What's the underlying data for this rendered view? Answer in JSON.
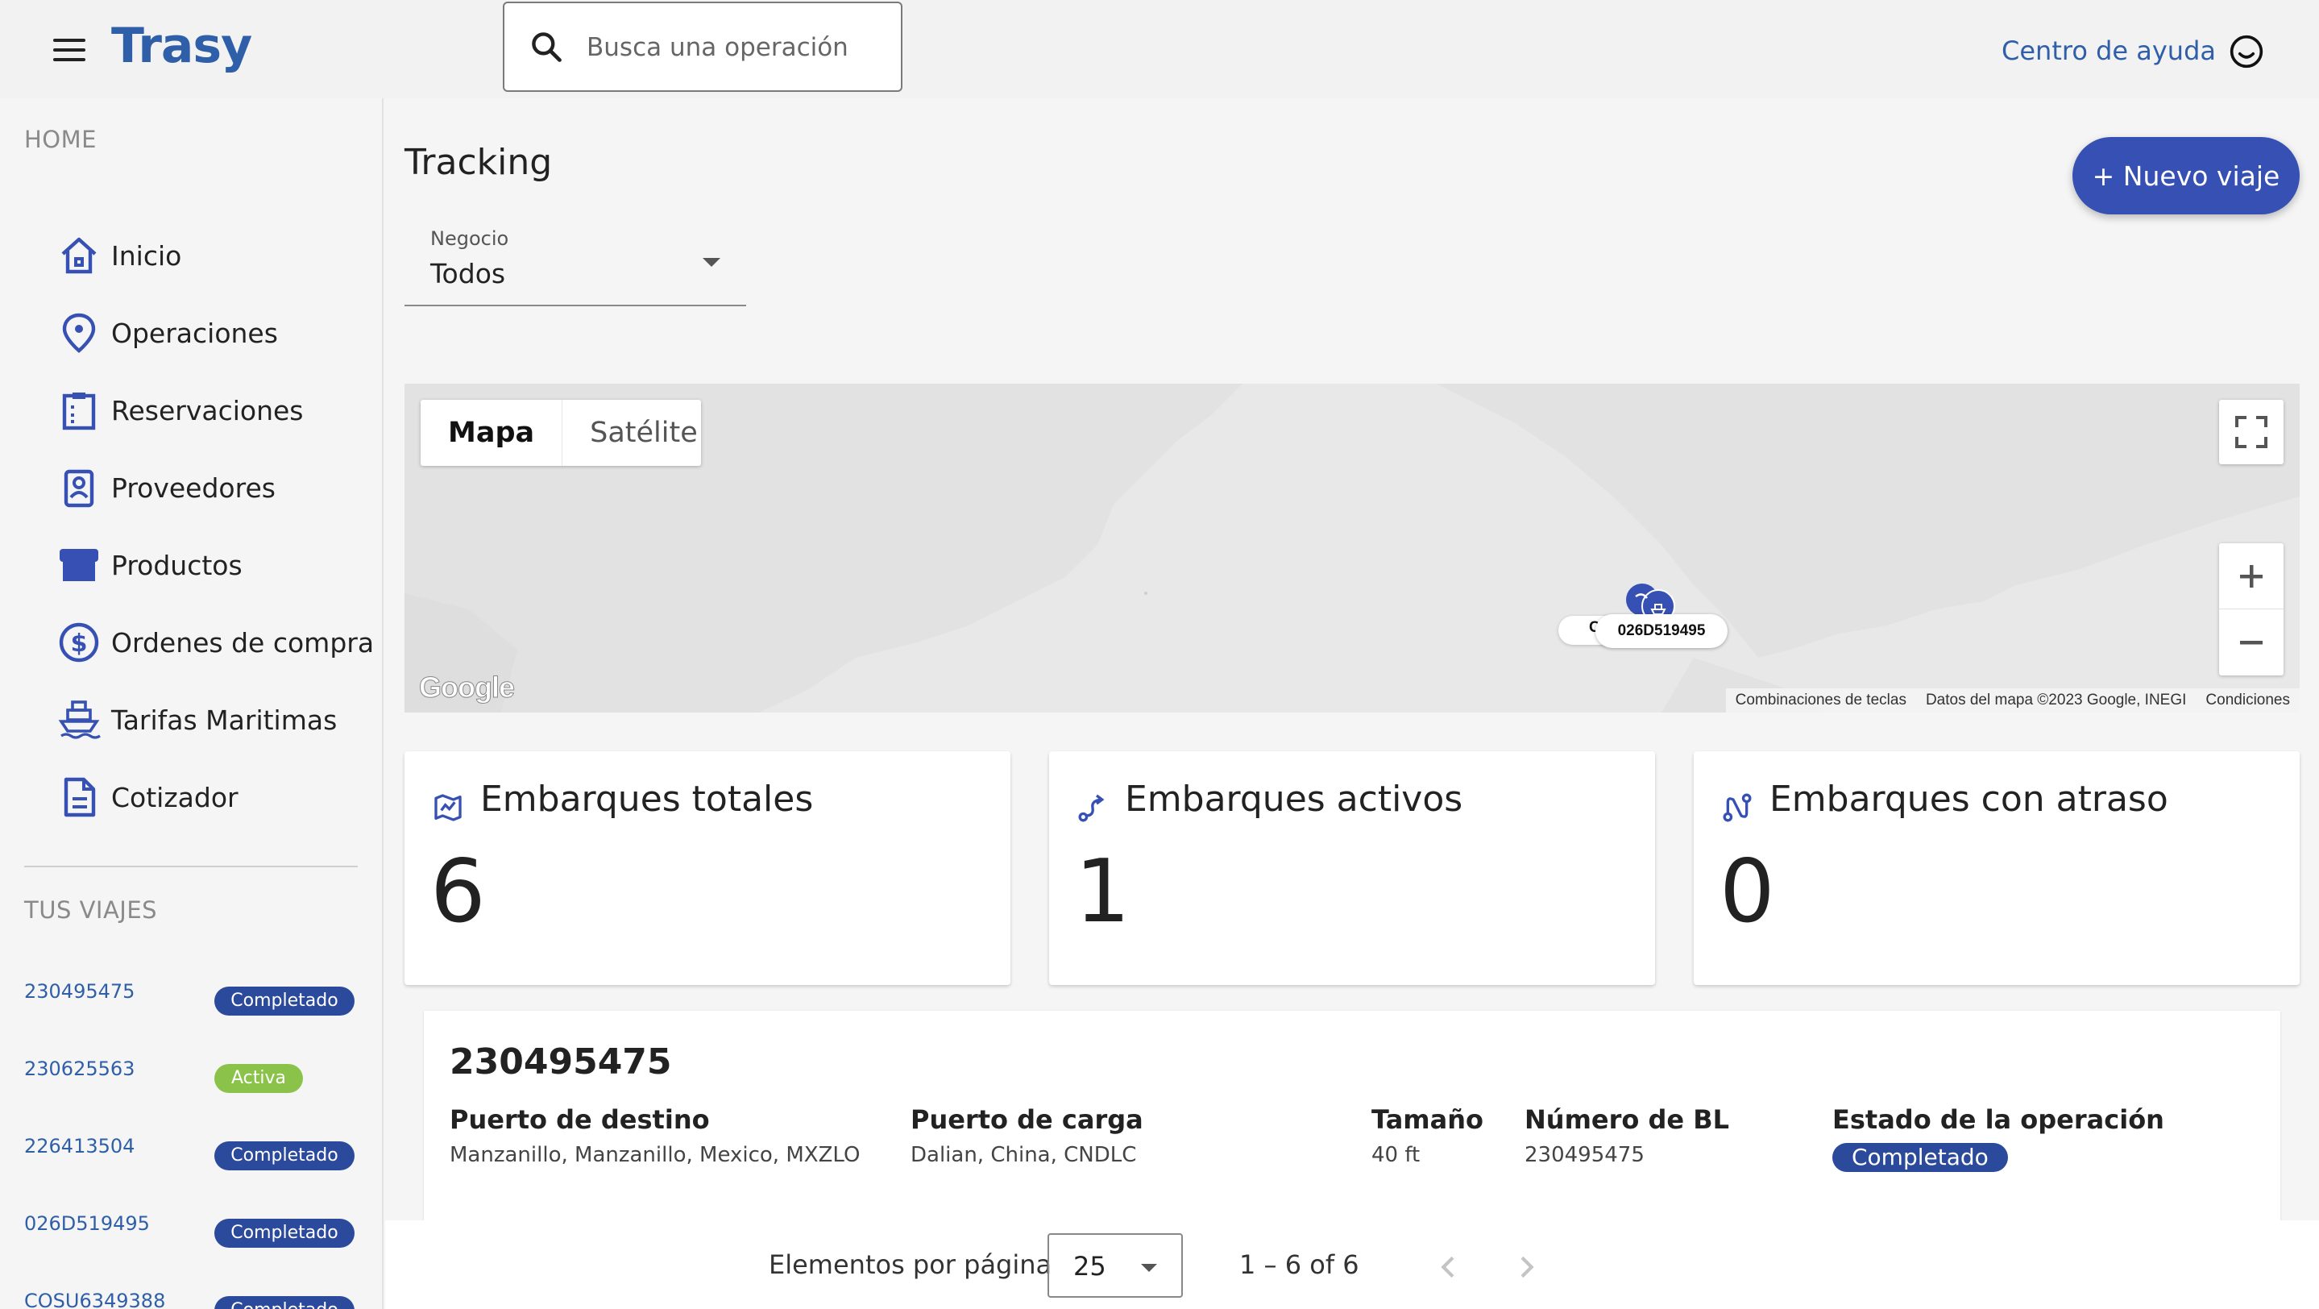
{
  "header": {
    "logo": "Trasy",
    "search_placeholder": "Busca una operación",
    "help_link": "Centro de ayuda"
  },
  "sidebar": {
    "home_label": "HOME",
    "items": [
      {
        "label": "Inicio",
        "icon": "home-icon"
      },
      {
        "label": "Operaciones",
        "icon": "location-pin-icon"
      },
      {
        "label": "Reservaciones",
        "icon": "clipboard-icon"
      },
      {
        "label": "Proveedores",
        "icon": "contact-card-icon"
      },
      {
        "label": "Productos",
        "icon": "store-icon"
      },
      {
        "label": "Ordenes de compra",
        "icon": "dollar-circle-icon"
      },
      {
        "label": "Tarifas Maritimas",
        "icon": "ship-icon"
      },
      {
        "label": "Cotizador",
        "icon": "document-icon"
      }
    ],
    "trips_label": "TUS VIAJES",
    "trips": [
      {
        "id": "230495475",
        "status": "Completado"
      },
      {
        "id": "230625563",
        "status": "Activa"
      },
      {
        "id": "226413504",
        "status": "Completado"
      },
      {
        "id": "026D519495",
        "status": "Completado"
      },
      {
        "id": "COSU6349388",
        "status": "Completado"
      }
    ]
  },
  "main": {
    "title": "Tracking",
    "new_trip_button": "+ Nuevo viaje",
    "business_filter": {
      "label": "Negocio",
      "value": "Todos"
    }
  },
  "map": {
    "tabs": [
      "Mapa",
      "Satélite"
    ],
    "active_tab": "Mapa",
    "google_logo": "Google",
    "attribution": [
      "Combinaciones de teclas",
      "Datos del mapa ©2023 Google, INEGI",
      "Condiciones"
    ],
    "marker_label": "026D519495",
    "marker_label_back": "C"
  },
  "stats": [
    {
      "title": "Embarques totales",
      "value": "6",
      "icon": "route-map-icon"
    },
    {
      "title": "Embarques activos",
      "value": "1",
      "icon": "route-arrow-icon"
    },
    {
      "title": "Embarques con atraso",
      "value": "0",
      "icon": "route-delay-icon"
    }
  ],
  "shipment": {
    "id": "230495475",
    "columns": [
      {
        "label": "Puerto de destino",
        "value": "Manzanillo, Manzanillo, Mexico, MXZLO"
      },
      {
        "label": "Puerto de carga",
        "value": "Dalian, China, CNDLC"
      },
      {
        "label": "Tamaño",
        "value": "40 ft"
      },
      {
        "label": "Número de BL",
        "value": "230495475"
      }
    ],
    "status_label": "Estado de la operación",
    "status_value": "Completado"
  },
  "pagination": {
    "items_per_page_label": "Elementos por página",
    "page_size": "25",
    "range": "1 – 6 of 6"
  },
  "colors": {
    "brand": "#2f5fa8",
    "primary_button": "#3650b3",
    "badge_completed": "#2c4a9c",
    "badge_active": "#8bc34a"
  }
}
